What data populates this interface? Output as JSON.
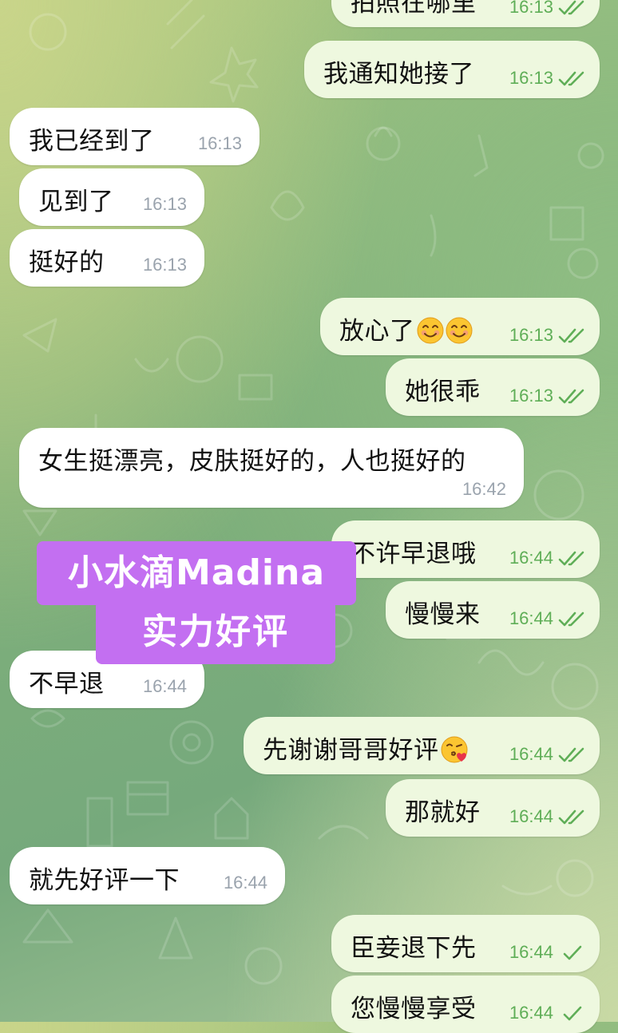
{
  "watermark": {
    "line1": "小水滴Madina",
    "line2": "实力好评",
    "color": "#c36ff1"
  },
  "messages": [
    {
      "dir": "out",
      "text": "拍照在哪里",
      "time": "16:13",
      "status": "read"
    },
    {
      "dir": "out",
      "text": "我通知她接了",
      "time": "16:13",
      "status": "read"
    },
    {
      "dir": "in",
      "text": "我已经到了",
      "time": "16:13"
    },
    {
      "dir": "in",
      "text": "见到了",
      "time": "16:13"
    },
    {
      "dir": "in",
      "text": "挺好的",
      "time": "16:13"
    },
    {
      "dir": "out",
      "text": "放心了",
      "emojis": [
        "smiling-face-icon",
        "smiling-face-icon"
      ],
      "time": "16:13",
      "status": "read"
    },
    {
      "dir": "out",
      "text": "她很乖",
      "time": "16:13",
      "status": "read"
    },
    {
      "dir": "in",
      "text": "女生挺漂亮，皮肤挺好的，人也挺好的",
      "time": "16:42"
    },
    {
      "dir": "out",
      "text": "不许早退哦",
      "time": "16:44",
      "status": "read"
    },
    {
      "dir": "out",
      "text": "慢慢来",
      "time": "16:44",
      "status": "read"
    },
    {
      "dir": "in",
      "text": "不早退",
      "time": "16:44"
    },
    {
      "dir": "out",
      "text": "先谢谢哥哥好评",
      "emojis": [
        "kissing-face-icon"
      ],
      "time": "16:44",
      "status": "read"
    },
    {
      "dir": "out",
      "text": "那就好",
      "time": "16:44",
      "status": "read"
    },
    {
      "dir": "in",
      "text": "就先好评一下",
      "time": "16:44"
    },
    {
      "dir": "out",
      "text": "臣妾退下先",
      "time": "16:44",
      "status": "sent"
    },
    {
      "dir": "out",
      "text": "您慢慢享受",
      "time": "16:44",
      "status": "sent"
    }
  ],
  "colors": {
    "outgoing_bubble": "#eef8df",
    "incoming_bubble": "#ffffff",
    "check_green": "#5fae57",
    "time_gray": "#9aa3ad"
  }
}
